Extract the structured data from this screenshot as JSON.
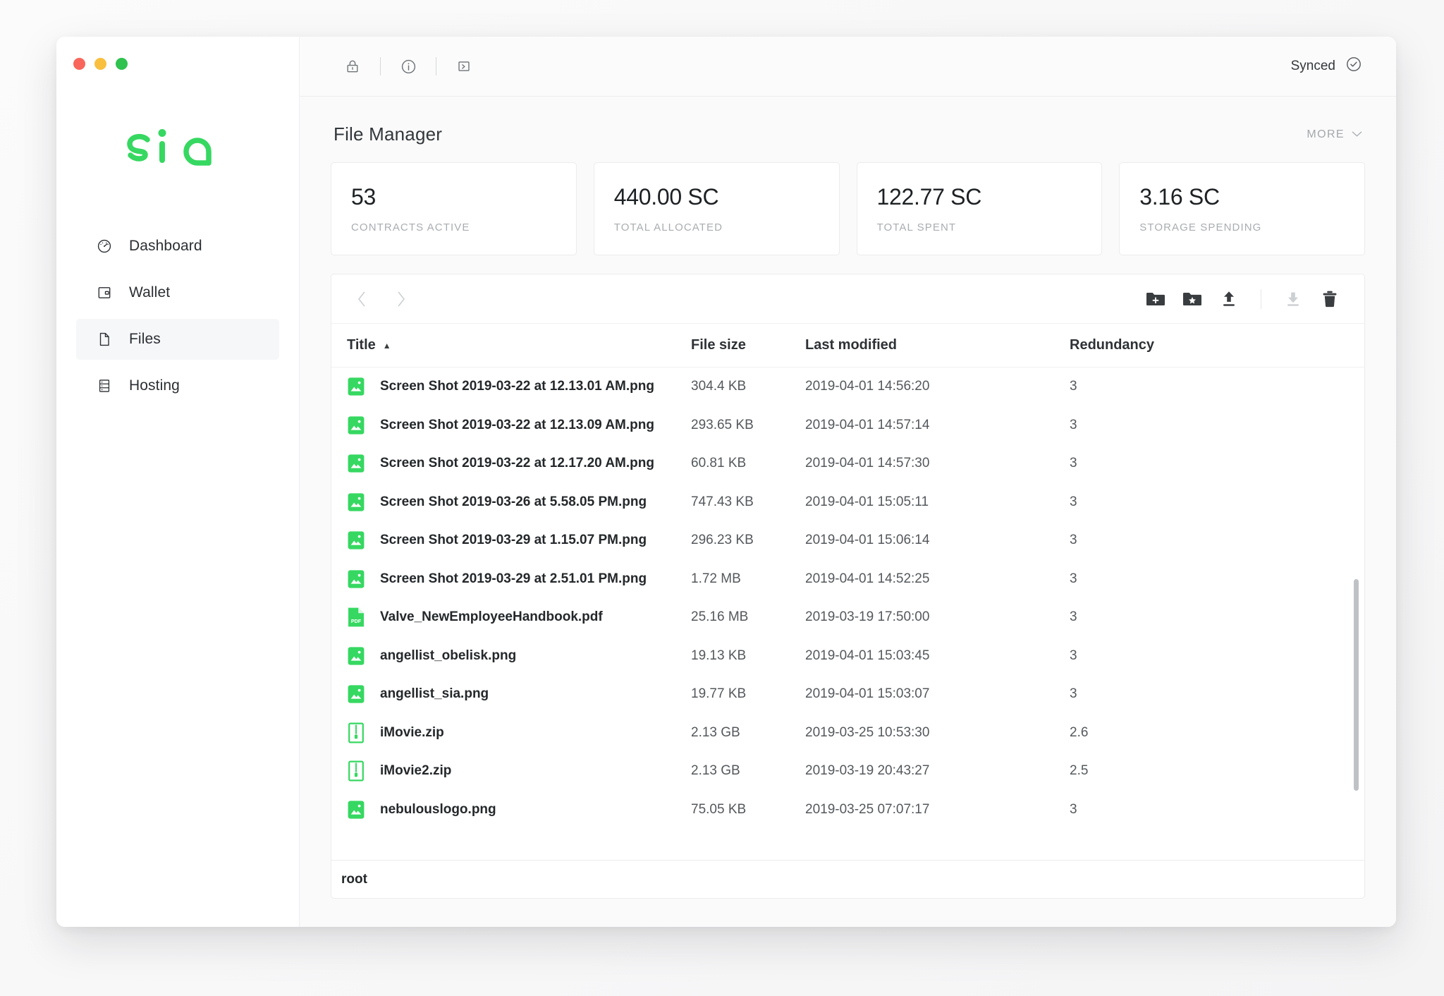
{
  "window": {
    "traffic_lights": [
      "close",
      "minimize",
      "zoom"
    ],
    "colors": {
      "accent_green": "#36d861",
      "red": "#f8665c",
      "yellow": "#f9bf3f",
      "green": "#2fc24f"
    }
  },
  "brand": {
    "logo_text": "sia"
  },
  "sidebar": {
    "items": [
      {
        "label": "Dashboard",
        "icon": "speedometer-icon",
        "active": false
      },
      {
        "label": "Wallet",
        "icon": "wallet-icon",
        "active": false
      },
      {
        "label": "Files",
        "icon": "file-icon",
        "active": true
      },
      {
        "label": "Hosting",
        "icon": "server-rack-icon",
        "active": false
      }
    ]
  },
  "topbar": {
    "tools": [
      {
        "name": "lock-icon",
        "label": "Lock"
      },
      {
        "name": "info-icon",
        "label": "Info"
      },
      {
        "name": "terminal-icon",
        "label": "Console"
      }
    ],
    "status_label": "Synced",
    "status_icon": "check-circle-icon"
  },
  "page": {
    "title": "File Manager",
    "more_label": "MORE",
    "more_icon": "chevron-down-icon"
  },
  "stats": [
    {
      "value": "53",
      "label": "CONTRACTS ACTIVE"
    },
    {
      "value": "440.00 SC",
      "label": "TOTAL ALLOCATED"
    },
    {
      "value": "122.77 SC",
      "label": "TOTAL SPENT"
    },
    {
      "value": "3.16 SC",
      "label": "STORAGE SPENDING"
    }
  ],
  "file_toolbar": {
    "back_icon": "chevron-left-icon",
    "forward_icon": "chevron-right-icon",
    "actions": [
      {
        "name": "new-folder-icon",
        "label": "New folder",
        "disabled": false
      },
      {
        "name": "favorite-folder-icon",
        "label": "Favorite folder",
        "disabled": false
      },
      {
        "name": "upload-icon",
        "label": "Upload",
        "disabled": false
      },
      {
        "name": "download-icon",
        "label": "Download",
        "disabled": true
      },
      {
        "name": "delete-icon",
        "label": "Delete",
        "disabled": false
      }
    ]
  },
  "table": {
    "columns": [
      "Title",
      "File size",
      "Last modified",
      "Redundancy"
    ],
    "sort_column": "Title",
    "sort_direction": "ascending",
    "rows": [
      {
        "icon": "image-file-icon",
        "title": "Screen Shot 2019-03-22 at 12.13.01 AM.png",
        "size": "304.4 KB",
        "modified": "2019-04-01 14:56:20",
        "redundancy": "3"
      },
      {
        "icon": "image-file-icon",
        "title": "Screen Shot 2019-03-22 at 12.13.09 AM.png",
        "size": "293.65 KB",
        "modified": "2019-04-01 14:57:14",
        "redundancy": "3"
      },
      {
        "icon": "image-file-icon",
        "title": "Screen Shot 2019-03-22 at 12.17.20 AM.png",
        "size": "60.81 KB",
        "modified": "2019-04-01 14:57:30",
        "redundancy": "3"
      },
      {
        "icon": "image-file-icon",
        "title": "Screen Shot 2019-03-26 at 5.58.05 PM.png",
        "size": "747.43 KB",
        "modified": "2019-04-01 15:05:11",
        "redundancy": "3"
      },
      {
        "icon": "image-file-icon",
        "title": "Screen Shot 2019-03-29 at 1.15.07 PM.png",
        "size": "296.23 KB",
        "modified": "2019-04-01 15:06:14",
        "redundancy": "3"
      },
      {
        "icon": "image-file-icon",
        "title": "Screen Shot 2019-03-29 at 2.51.01 PM.png",
        "size": "1.72 MB",
        "modified": "2019-04-01 14:52:25",
        "redundancy": "3"
      },
      {
        "icon": "pdf-file-icon",
        "title": "Valve_NewEmployeeHandbook.pdf",
        "size": "25.16 MB",
        "modified": "2019-03-19 17:50:00",
        "redundancy": "3"
      },
      {
        "icon": "image-file-icon",
        "title": "angellist_obelisk.png",
        "size": "19.13 KB",
        "modified": "2019-04-01 15:03:45",
        "redundancy": "3"
      },
      {
        "icon": "image-file-icon",
        "title": "angellist_sia.png",
        "size": "19.77 KB",
        "modified": "2019-04-01 15:03:07",
        "redundancy": "3"
      },
      {
        "icon": "zip-file-icon",
        "title": "iMovie.zip",
        "size": "2.13 GB",
        "modified": "2019-03-25 10:53:30",
        "redundancy": "2.6"
      },
      {
        "icon": "zip-file-icon",
        "title": "iMovie2.zip",
        "size": "2.13 GB",
        "modified": "2019-03-19 20:43:27",
        "redundancy": "2.5"
      },
      {
        "icon": "image-file-icon",
        "title": "nebulouslogo.png",
        "size": "75.05 KB",
        "modified": "2019-03-25 07:07:17",
        "redundancy": "3"
      }
    ]
  },
  "footer": {
    "path": "root"
  }
}
